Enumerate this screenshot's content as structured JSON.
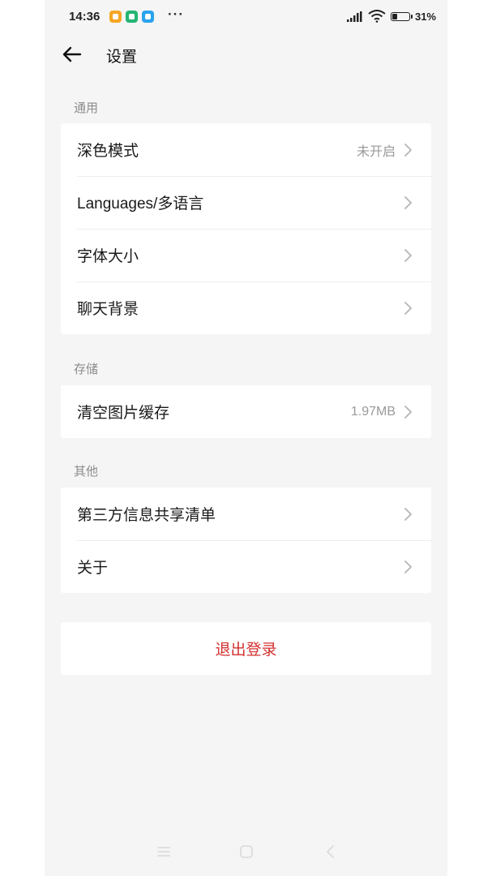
{
  "status_bar": {
    "time": "14:36",
    "more": "···",
    "battery_text": "31%",
    "battery_level": 0.31
  },
  "header": {
    "title": "设置"
  },
  "sections": [
    {
      "label": "通用",
      "items": [
        {
          "label": "深色模式",
          "value": "未开启"
        },
        {
          "label": "Languages/多语言",
          "value": ""
        },
        {
          "label": "字体大小",
          "value": ""
        },
        {
          "label": "聊天背景",
          "value": ""
        }
      ]
    },
    {
      "label": "存储",
      "items": [
        {
          "label": "清空图片缓存",
          "value": "1.97MB"
        }
      ]
    },
    {
      "label": "其他",
      "items": [
        {
          "label": "第三方信息共享清单",
          "value": ""
        },
        {
          "label": "关于",
          "value": ""
        }
      ]
    }
  ],
  "logout": {
    "label": "退出登录"
  },
  "colors": {
    "background": "#f5f5f5",
    "card": "#ffffff",
    "logout_text": "#d32f2f",
    "section_label": "#8c8c8c"
  },
  "icons": {
    "back": "arrow-left-icon",
    "chevron": "chevron-right-icon",
    "nav_menu": "menu-icon",
    "nav_home": "home-icon",
    "nav_back": "back-icon"
  }
}
